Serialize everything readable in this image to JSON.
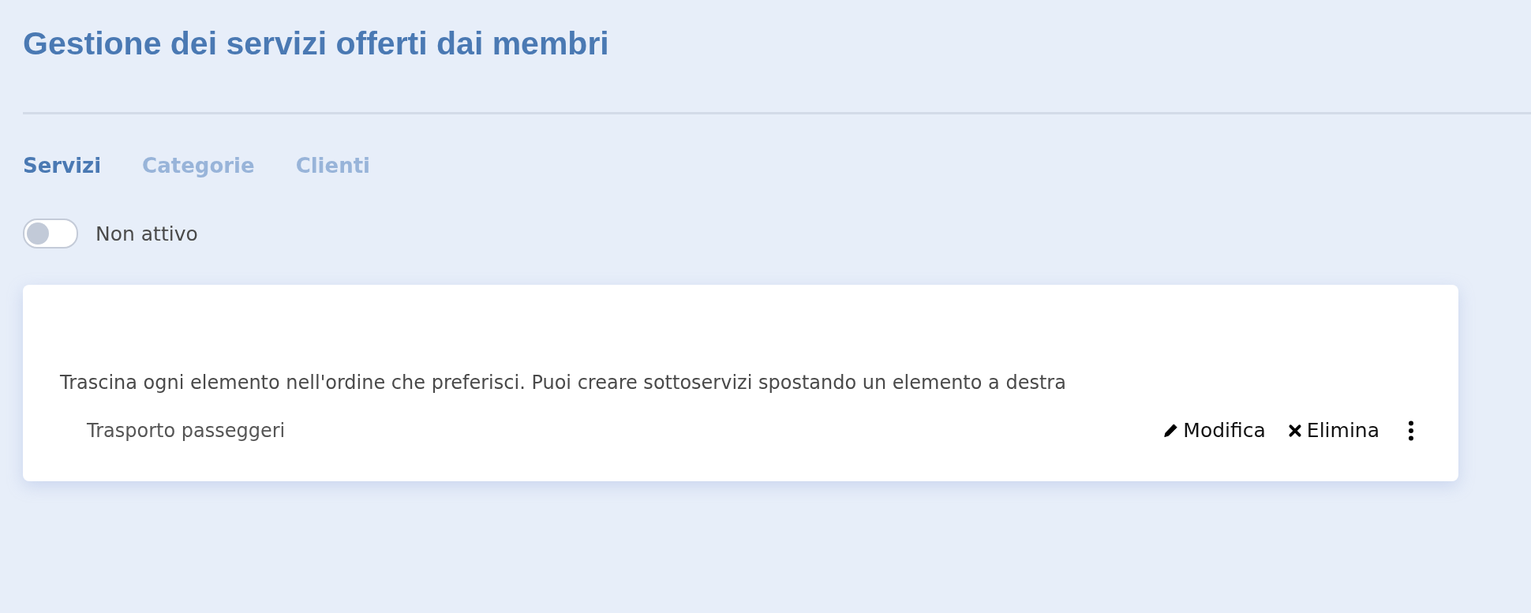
{
  "title": "Gestione dei servizi offerti dai membri",
  "tabs": [
    {
      "label": "Servizi",
      "selected": true
    },
    {
      "label": "Categorie",
      "selected": false
    },
    {
      "label": "Clienti",
      "selected": false
    }
  ],
  "toggle": {
    "on": false,
    "label": "Non attivo"
  },
  "card": {
    "instruction": "Trascina ogni elemento nell'ordine che preferisci. Puoi creare sottoservizi spostando un elemento a destra",
    "items": [
      {
        "name": "Trasporto passeggeri",
        "actions": [
          {
            "kind": "edit",
            "label": "Modifica"
          },
          {
            "kind": "delete",
            "label": "Elimina"
          },
          {
            "kind": "menu"
          }
        ]
      }
    ]
  }
}
